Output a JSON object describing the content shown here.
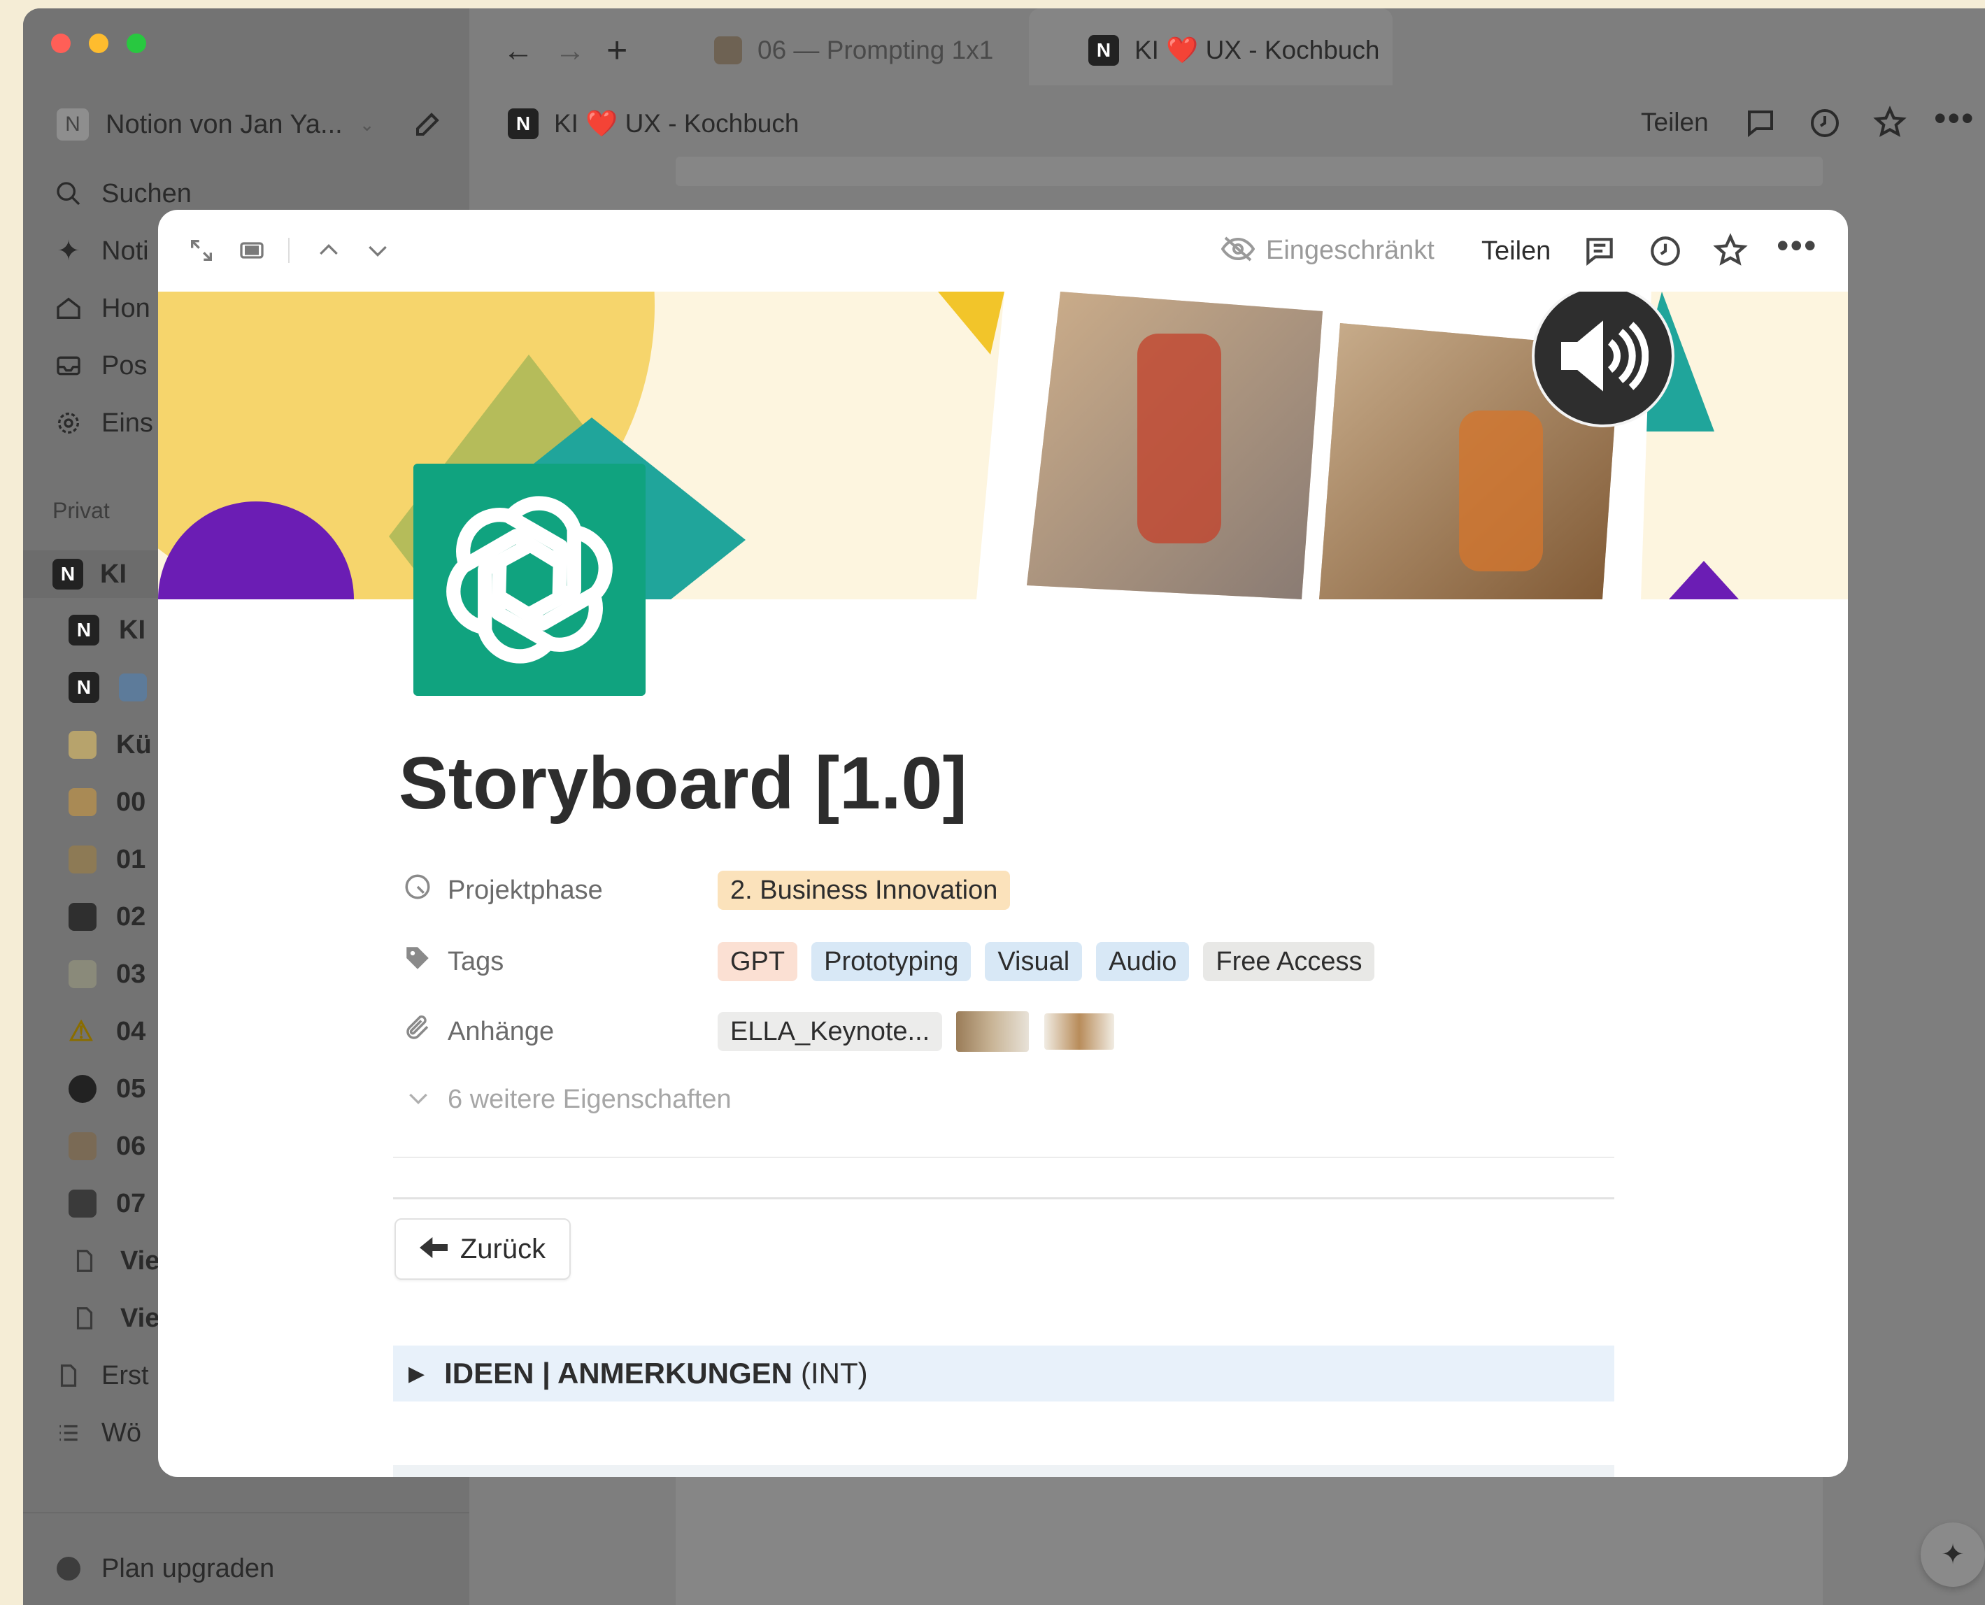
{
  "window": {
    "traffic_lights": [
      "#ff5f57",
      "#febc2e",
      "#28c840"
    ],
    "tabs": [
      {
        "label": "06 — Prompting 1x1",
        "icon": "wizard-emoji"
      },
      {
        "label": "KI ❤️ UX - Kochbuch",
        "icon": "notion-logo"
      }
    ]
  },
  "sidebar": {
    "workspace": {
      "initial": "N",
      "name": "Notion von Jan Ya..."
    },
    "nav": [
      {
        "label": "Suchen",
        "icon": "search-icon"
      },
      {
        "label": "Noti",
        "icon": "sparkle-icon"
      },
      {
        "label": "Hon",
        "icon": "home-icon"
      },
      {
        "label": "Pos",
        "icon": "inbox-icon"
      },
      {
        "label": "Eins",
        "icon": "settings-icon"
      }
    ],
    "section_label": "Privat",
    "pages": [
      {
        "label": "KI",
        "icon": "notion-logo"
      },
      {
        "label": "KI",
        "icon": "notion-logo"
      },
      {
        "label": "",
        "icon": "notion-logo"
      },
      {
        "label": "Kü",
        "icon": "chef-emoji"
      },
      {
        "label": "00",
        "icon": "box-emoji"
      },
      {
        "label": "01",
        "icon": "worker-emoji"
      },
      {
        "label": "02",
        "icon": "muscle-emoji"
      },
      {
        "label": "03",
        "icon": "bulb-emoji"
      },
      {
        "label": "04",
        "icon": "warning-emoji"
      },
      {
        "label": "05",
        "icon": "bomb-emoji"
      },
      {
        "label": "06",
        "icon": "wizard-emoji"
      },
      {
        "label": "07",
        "icon": "hammer-emoji"
      },
      {
        "label": "Vie",
        "icon": "doc-icon"
      },
      {
        "label": "Vie",
        "icon": "doc-icon"
      }
    ],
    "bottom_pages": [
      {
        "label": "Erst",
        "icon": "doc-icon"
      },
      {
        "label": "Wö",
        "icon": "list-icon"
      }
    ],
    "upgrade_label": "Plan upgraden"
  },
  "header": {
    "breadcrumb": "KI ❤️ UX - Kochbuch",
    "share_label": "Teilen"
  },
  "modal": {
    "restricted_label": "Eingeschränkt",
    "share_label": "Teilen",
    "title": "Storyboard [1.0]",
    "properties": {
      "phase_label": "Projektphase",
      "phase_value": "2. Business Innovation",
      "tags_label": "Tags",
      "tags": [
        {
          "text": "GPT",
          "color": "#fbe0d3"
        },
        {
          "text": "Prototyping",
          "color": "#d8e8f6"
        },
        {
          "text": "Visual",
          "color": "#d8e8f6"
        },
        {
          "text": "Audio",
          "color": "#d8e8f6"
        },
        {
          "text": "Free Access",
          "color": "#e8e8e6"
        }
      ],
      "attachments_label": "Anhänge",
      "attachment_file": "ELLA_Keynote...",
      "more_label": "6 weitere Eigenschaften"
    },
    "back_button": "Zurück",
    "toggle_heading": {
      "bold": "IDEEN | ANMERKUNGEN",
      "suffix": "(INT)"
    }
  },
  "colors": {
    "accent_green": "#10a37f",
    "tag_orange": "#fbe0d3",
    "phase_bg": "#fbe2bb",
    "toggle_bg": "#e8f1fa"
  }
}
